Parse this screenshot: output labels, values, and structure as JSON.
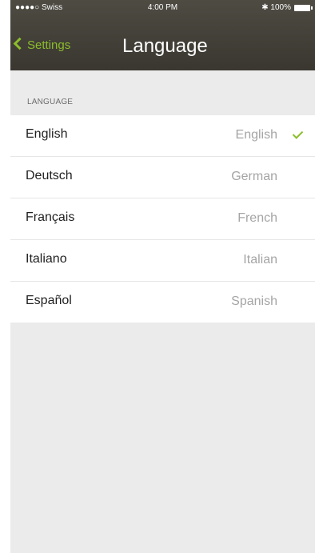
{
  "status_bar": {
    "carrier": "●●●●○ Swiss",
    "time": "4:00 PM",
    "battery": "100%"
  },
  "nav": {
    "back_label": "Settings",
    "title": "Language"
  },
  "section": {
    "header": "LANGUAGE"
  },
  "languages": [
    {
      "native": "English",
      "english": "English",
      "selected": true
    },
    {
      "native": "Deutsch",
      "english": "German",
      "selected": false
    },
    {
      "native": "Français",
      "english": "French",
      "selected": false
    },
    {
      "native": "Italiano",
      "english": "Italian",
      "selected": false
    },
    {
      "native": "Español",
      "english": "Spanish",
      "selected": false
    }
  ],
  "colors": {
    "accent": "#8cbd2b",
    "nav_bar": "#45423a",
    "background": "#ebebeb"
  }
}
